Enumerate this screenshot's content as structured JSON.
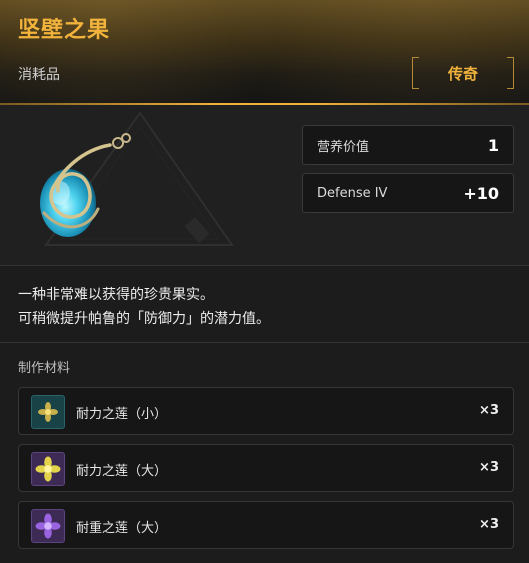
{
  "item": {
    "name": "坚壁之果",
    "category": "消耗品",
    "rarity": "传奇"
  },
  "stats": [
    {
      "label": "营养价值",
      "value": "1"
    },
    {
      "label": "Defense IV",
      "value": "+10"
    }
  ],
  "description": {
    "line1": "一种非常难以获得的珍贵果实。",
    "line2": "可稍微提升帕鲁的「防御力」的潜力值。"
  },
  "materials": {
    "title": "制作材料",
    "items": [
      {
        "name": "耐力之莲（小）",
        "qty": "×3",
        "icon": "lotus-small-icon",
        "icon_color": "#c9b04a"
      },
      {
        "name": "耐力之莲（大）",
        "qty": "×3",
        "icon": "lotus-large-icon",
        "icon_color": "#e2d24c"
      },
      {
        "name": "耐重之莲（大）",
        "qty": "×3",
        "icon": "lotus-purple-icon",
        "icon_color": "#9a63e0"
      }
    ]
  },
  "colors": {
    "accent": "#f1b33c",
    "background": "#1c1c1c",
    "panel": "#161616"
  }
}
